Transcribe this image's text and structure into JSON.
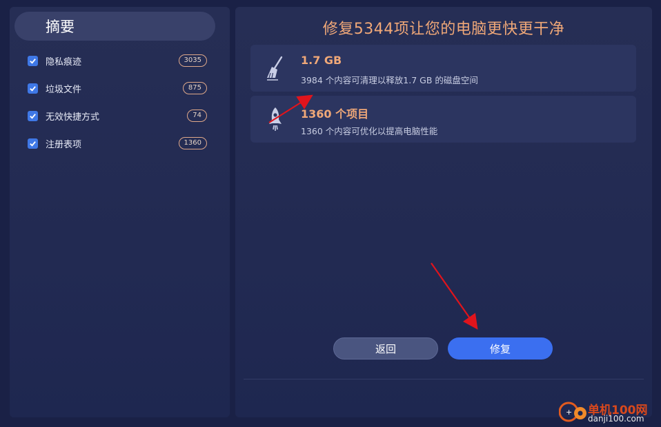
{
  "sidebar": {
    "header": "摘要",
    "items": [
      {
        "label": "隐私痕迹",
        "count": "3035",
        "checked": true
      },
      {
        "label": "垃圾文件",
        "count": "875",
        "checked": true
      },
      {
        "label": "无效快捷方式",
        "count": "74",
        "checked": true
      },
      {
        "label": "注册表项",
        "count": "1360",
        "checked": true
      }
    ]
  },
  "main": {
    "title": "修复5344项让您的电脑更快更干净",
    "cards": [
      {
        "icon": "broom-icon",
        "headline": "1.7 GB",
        "description": "3984 个内容可清理以释放1.7 GB 的磁盘空间"
      },
      {
        "icon": "rocket-icon",
        "headline": "1360 个项目",
        "description": "1360 个内容可优化以提高电脑性能"
      }
    ],
    "back_label": "返回",
    "fix_label": "修复"
  },
  "watermark": {
    "name": "单机100网",
    "url": "danji100.com"
  },
  "colors": {
    "background": "#1a2146",
    "panel": "#242c54",
    "accent": "#f0a878",
    "primary_button": "#3b6ff0",
    "checkbox": "#3f78e6",
    "annotation_arrow": "#e0141c"
  }
}
